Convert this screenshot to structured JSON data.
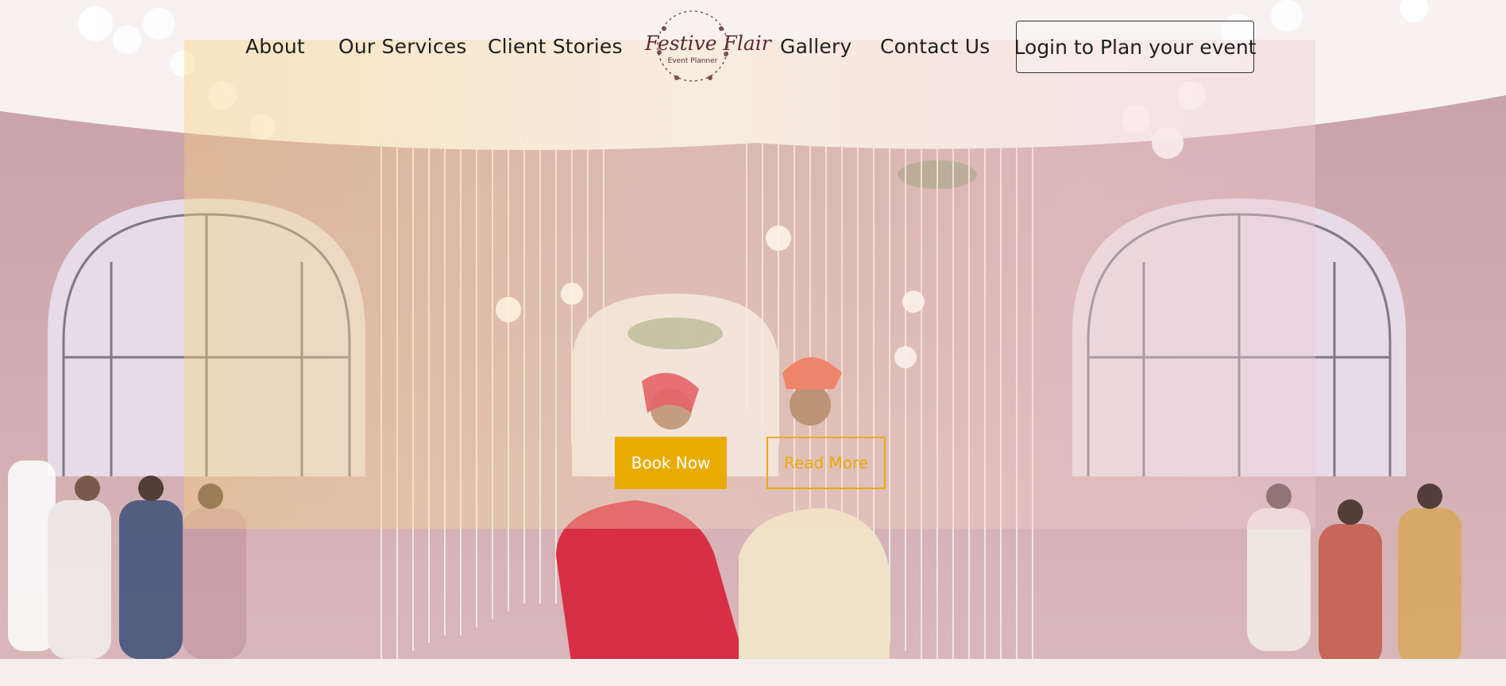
{
  "nav": {
    "items": [
      {
        "label": "About"
      },
      {
        "label": "Our Services"
      },
      {
        "label": "Client Stories"
      },
      {
        "label": "Gallery"
      },
      {
        "label": "Contact Us"
      }
    ],
    "login_label": "Login to Plan your event"
  },
  "logo": {
    "title": "Festive Flair",
    "subtitle": "Event Planner"
  },
  "hero": {
    "book_label": "Book Now",
    "read_label": "Read More"
  },
  "colors": {
    "accent": "#e8ab00",
    "logo": "#5c2a3a",
    "bride_dress": "#d8203a",
    "groom_turban": "#e8533a"
  }
}
